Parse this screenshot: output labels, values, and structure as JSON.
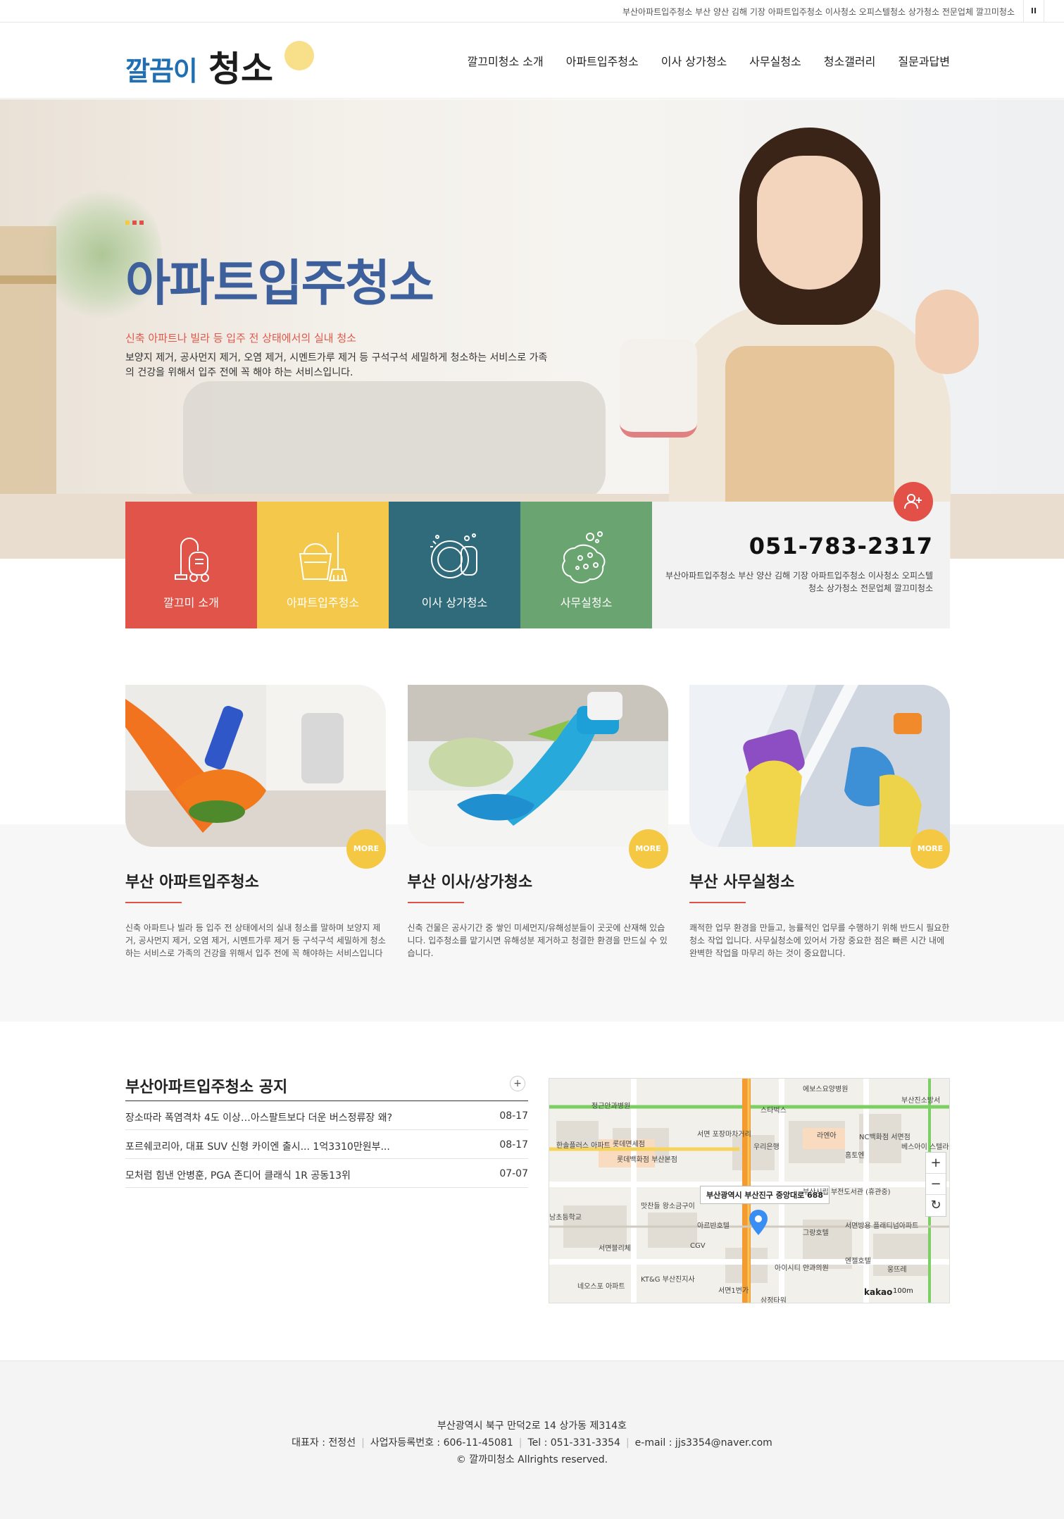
{
  "topbar": {
    "text": "부산아파트입주청소 부산 양산 김해 기장 아파트입주청소 이사청소 오피스텔청소 상가청소 전문업체 깔끄미청소",
    "pause_label": "II"
  },
  "header": {
    "logo_part1": "깔끔이",
    "logo_part2": "청소",
    "nav": [
      "깔끄미청소 소개",
      "아파트입주청소",
      "이사 상가청소",
      "사무실청소",
      "청소갤러리",
      "질문과답변"
    ]
  },
  "hero": {
    "title": "아파트입주청소",
    "subtitle": "신축 아파트나 빌라 등 입주 전 상태에서의 실내 청소",
    "description": "보양지 제거, 공사먼지 제거, 오염 제거, 시멘트가루 제거 등 구석구석 세밀하게 청소하는 서비스로 가족의 건강을 위해서 입주 전에 꼭 해야 하는 서비스입니다."
  },
  "quick_links": [
    {
      "label": "깔끄미 소개",
      "icon": "vacuum-icon",
      "color": "#e0544a"
    },
    {
      "label": "아파트입주청소",
      "icon": "bucket-mop-icon",
      "color": "#f4c84a"
    },
    {
      "label": "이사 상가청소",
      "icon": "plate-sponge-icon",
      "color": "#2f6b7a"
    },
    {
      "label": "사무실청소",
      "icon": "sponge-bubbles-icon",
      "color": "#6aa471"
    }
  ],
  "contact": {
    "phone": "051-783-2317",
    "description": "부산아파트입주청소 부산 양산 김해 기장 아파트입주청소 이사청소 오피스텔청소 상가청소 전문업체 깔끄미청소",
    "icon": "add-user-icon"
  },
  "services": [
    {
      "title": "부산 아파트입주청소",
      "more": "MORE",
      "text": "신축 아파트나 빌라 등 입주 전 상태에서의 실내 청소를 말하며 보양지 제거, 공사먼지 제거, 오염 제거, 시멘트가루 제거 등 구석구석 세밀하게 청소하는 서비스로 가족의 건강을 위해서 입주 전에 꼭 해야하는 서비스입니다"
    },
    {
      "title": "부산 이사/상가청소",
      "more": "MORE",
      "text": "신축 건물은 공사기간 중 쌓인 미세먼지/유해성분들이 곳곳에 산재해 있습니다. 입주청소를 맡기시면 유해성분 제거하고 청결한 환경을 만드실 수 있습니다."
    },
    {
      "title": "부산 사무실청소",
      "more": "MORE",
      "text": "쾌적한 업무 환경을 만들고, 능률적인 업무를 수행하기 위해 반드시 필요한 청소 작업 입니다. 사무실청소에 있어서 가장 중요한 점은 빠른 시간 내에 완벽한 작업을 마무리 하는 것이 중요합니다."
    }
  ],
  "notice": {
    "title": "부산아파트입주청소 공지",
    "plus": "+",
    "items": [
      {
        "title": "장소따라 폭염격차 4도 이상…아스팔트보다 더운 버스정류장 왜?",
        "date": "08-17"
      },
      {
        "title": "포르쉐코리아, 대표 SUV 신형 카이엔 출시... 1억3310만원부...",
        "date": "08-17"
      },
      {
        "title": "모처럼 힘낸 안병훈, PGA 존디어 클래식 1R 공동13위",
        "date": "07-07"
      }
    ]
  },
  "map": {
    "address_label": "부산광역시 부산진구 중앙대로 688",
    "zoom_in": "+",
    "zoom_out": "−",
    "reset": "↻",
    "brand": "kakao",
    "scale": "100m",
    "places": [
      "정근안과병원",
      "에보스요양병원",
      "부산진소방서",
      "스타벅스",
      "한솔플러스 아파트",
      "롯데면세점",
      "롯데백화점 부산본점",
      "서면 포장마차거리",
      "우리은행",
      "라엔아",
      "NC백화점 서면점",
      "홈토엔",
      "베스아이 스텔라",
      "부산시립 부전도서관 (휴관중)",
      "맛찬들 왕소금구이",
      "아르반호텔",
      "그랑호텔",
      "서면방용 플래티넘아파트",
      "엔젤호텔",
      "서면블리체",
      "CGV",
      "KT&G 부산진지사",
      "아이시티 안과의원",
      "웅뜨레",
      "네오스포 아파트",
      "서면1번가",
      "삼정타워",
      "남초등학교"
    ]
  },
  "footer": {
    "address": "부산광역시 북구 만덕2로 14 상가동 제314호",
    "ceo": "대표자 : 전정선",
    "biz_no": "사업자등록번호 : 606-11-45081",
    "tel": "Tel : 051-331-3354",
    "email": "e-mail : jjs3354@naver.com",
    "copyright": "© 깔까미청소 Allrights reserved."
  }
}
